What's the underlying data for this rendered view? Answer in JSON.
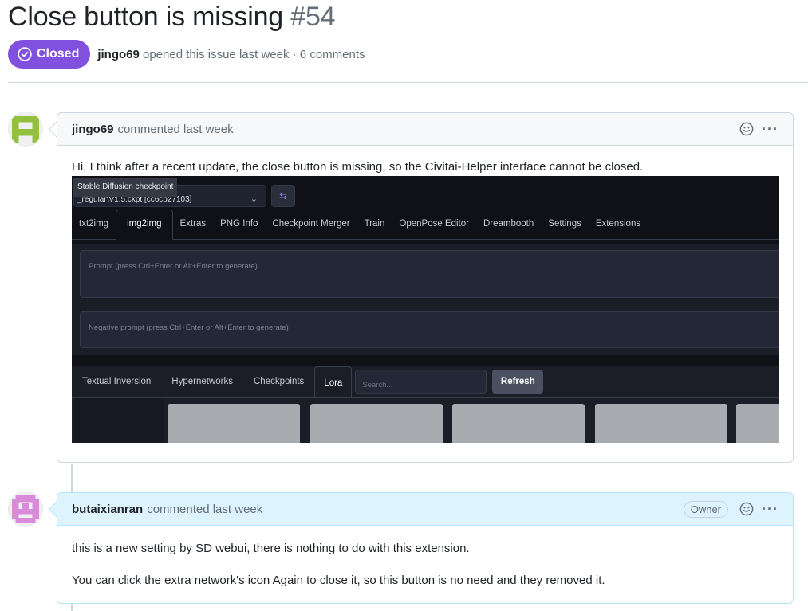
{
  "issue": {
    "title": "Close button is missing",
    "number": "#54",
    "state": "Closed",
    "author": "jingo69",
    "meta_text": "opened this issue last week · 6 comments"
  },
  "colors": {
    "closed_badge": "#8250df",
    "owner_header": "#ddf4ff"
  },
  "comments": [
    {
      "author": "jingo69",
      "action": "commented last week",
      "body": "Hi, I think after a recent update, the close button is missing, so the Civitai-Helper interface cannot be closed.",
      "screenshot": {
        "checkpoint_label": "Stable Diffusion checkpoint",
        "checkpoint_value": "_regular\\V1.5.ckpt [cc6cb27103]",
        "tabs": [
          "txt2img",
          "img2img",
          "Extras",
          "PNG Info",
          "Checkpoint Merger",
          "Train",
          "OpenPose Editor",
          "Dreambooth",
          "Settings",
          "Extensions"
        ],
        "active_tab": "img2img",
        "prompt_placeholder": "Prompt (press Ctrl+Enter or Alt+Enter to generate)",
        "negative_placeholder": "Negative prompt (press Ctrl+Enter or Alt+Enter to generate)",
        "network_tabs": [
          "Textual Inversion",
          "Hypernetworks",
          "Checkpoints",
          "Lora"
        ],
        "active_network_tab": "Lora",
        "search_placeholder": "Search...",
        "refresh_label": "Refresh"
      }
    },
    {
      "author": "butaixianran",
      "action": "commented last week",
      "role": "Owner",
      "paragraphs": [
        "this is a new setting by SD webui, there is nothing to do with this extension.",
        "You can click the extra network's icon Again to close it, so this button is no need and they removed it."
      ]
    }
  ]
}
